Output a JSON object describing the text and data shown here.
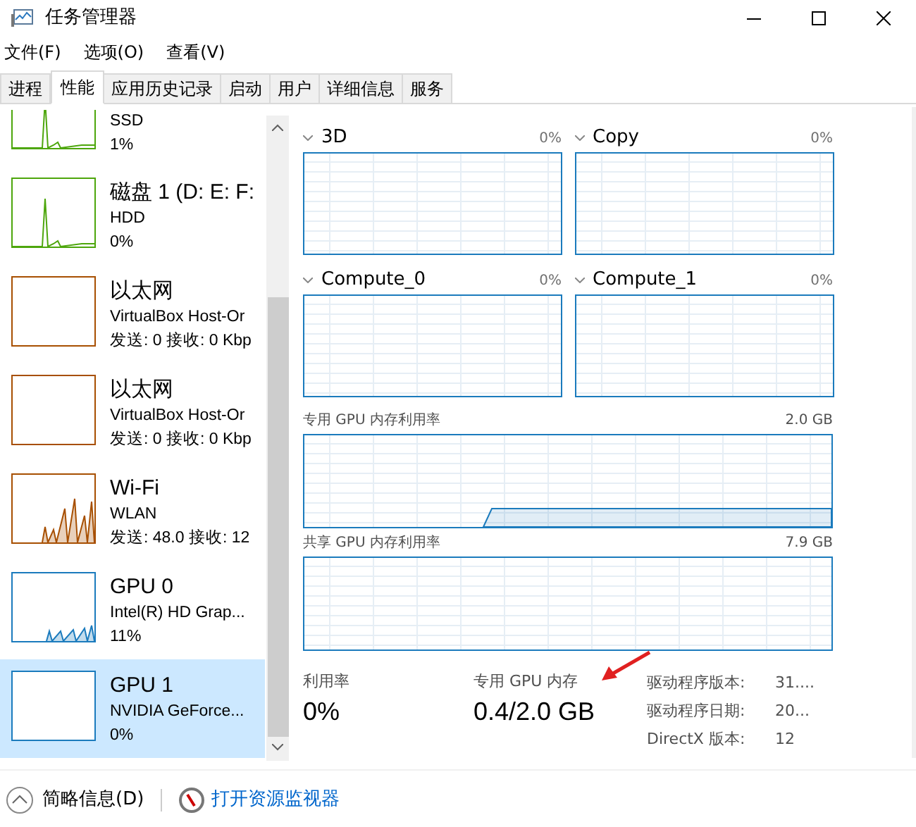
{
  "window": {
    "title": "任务管理器"
  },
  "menu": [
    "文件(F)",
    "选项(O)",
    "查看(V)"
  ],
  "tabs": [
    {
      "label": "进程",
      "selected": false
    },
    {
      "label": "性能",
      "selected": true
    },
    {
      "label": "应用历史记录",
      "selected": false
    },
    {
      "label": "启动",
      "selected": false
    },
    {
      "label": "用户",
      "selected": false
    },
    {
      "label": "详细信息",
      "selected": false
    },
    {
      "label": "服务",
      "selected": false
    }
  ],
  "sidebar": {
    "items": [
      {
        "kind": "disk",
        "subtitle": "SSD",
        "reading": "1%",
        "selected": false
      },
      {
        "kind": "disk",
        "title": "磁盘 1 (D: E: F:",
        "subtitle": "HDD",
        "reading": "0%",
        "selected": false
      },
      {
        "kind": "ethernet",
        "title": "以太网",
        "subtitle": "VirtualBox Host-Or",
        "reading": "发送: 0 接收: 0 Kbp",
        "selected": false
      },
      {
        "kind": "ethernet",
        "title": "以太网",
        "subtitle": "VirtualBox Host-Or",
        "reading": "发送: 0 接收: 0 Kbp",
        "selected": false
      },
      {
        "kind": "wifi",
        "title": "Wi-Fi",
        "subtitle": "WLAN",
        "reading": "发送: 48.0 接收: 12",
        "selected": false
      },
      {
        "kind": "gpu",
        "title": "GPU 0",
        "subtitle": "Intel(R) HD Grap...",
        "reading": "11%",
        "selected": false
      },
      {
        "kind": "gpu_idle",
        "title": "GPU 1",
        "subtitle": "NVIDIA GeForce...",
        "reading": "0%",
        "selected": true
      }
    ]
  },
  "engines": [
    {
      "name": "3D",
      "reading": "0%"
    },
    {
      "name": "Copy",
      "reading": "0%"
    },
    {
      "name": "Compute_0",
      "reading": "0%"
    },
    {
      "name": "Compute_1",
      "reading": "0%"
    }
  ],
  "memory_graphs": [
    {
      "kind": "dedicated",
      "label": "专用 GPU 内存利用率",
      "total": "2.0 GB"
    },
    {
      "kind": "shared",
      "label": "共享 GPU 内存利用率",
      "total": "7.9 GB"
    }
  ],
  "stats": [
    {
      "label": "利用率",
      "value": "0%"
    },
    {
      "label": "专用 GPU 内存",
      "value": "0.4/2.0 GB"
    }
  ],
  "details": [
    {
      "label": "驱动程序版本:",
      "value": "31...."
    },
    {
      "label": "驱动程序日期:",
      "value": "20..."
    },
    {
      "label": "DirectX 版本:",
      "value": "12"
    }
  ],
  "footer": {
    "summary_button": "简略信息(D)",
    "monitor_link": "打开资源监视器"
  }
}
